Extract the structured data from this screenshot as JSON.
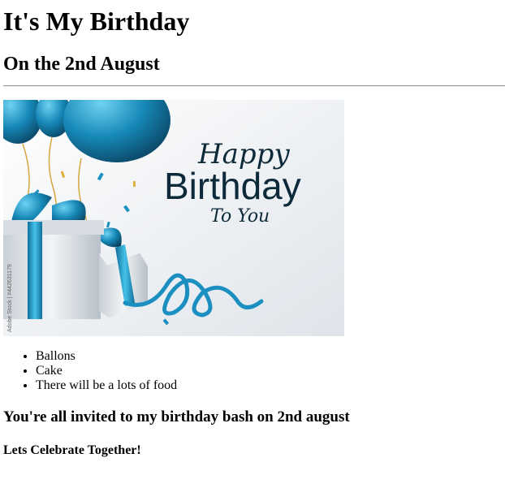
{
  "page": {
    "title": "It's My Birthday",
    "subtitle": "On the 2nd August",
    "banner": {
      "line1": "Happy",
      "line2": "Birthday",
      "line3": "To You",
      "watermark": "Adobe Stock | #442631179",
      "colors": {
        "accent": "#1a8fc0",
        "dark": "#0d2a3a",
        "bg": "#eef1f5"
      }
    },
    "list": [
      "Ballons",
      "Cake",
      "There will be a lots of food"
    ],
    "invite": "You're all invited to my birthday bash on 2nd august",
    "closing": "Lets Celebrate Together!"
  }
}
